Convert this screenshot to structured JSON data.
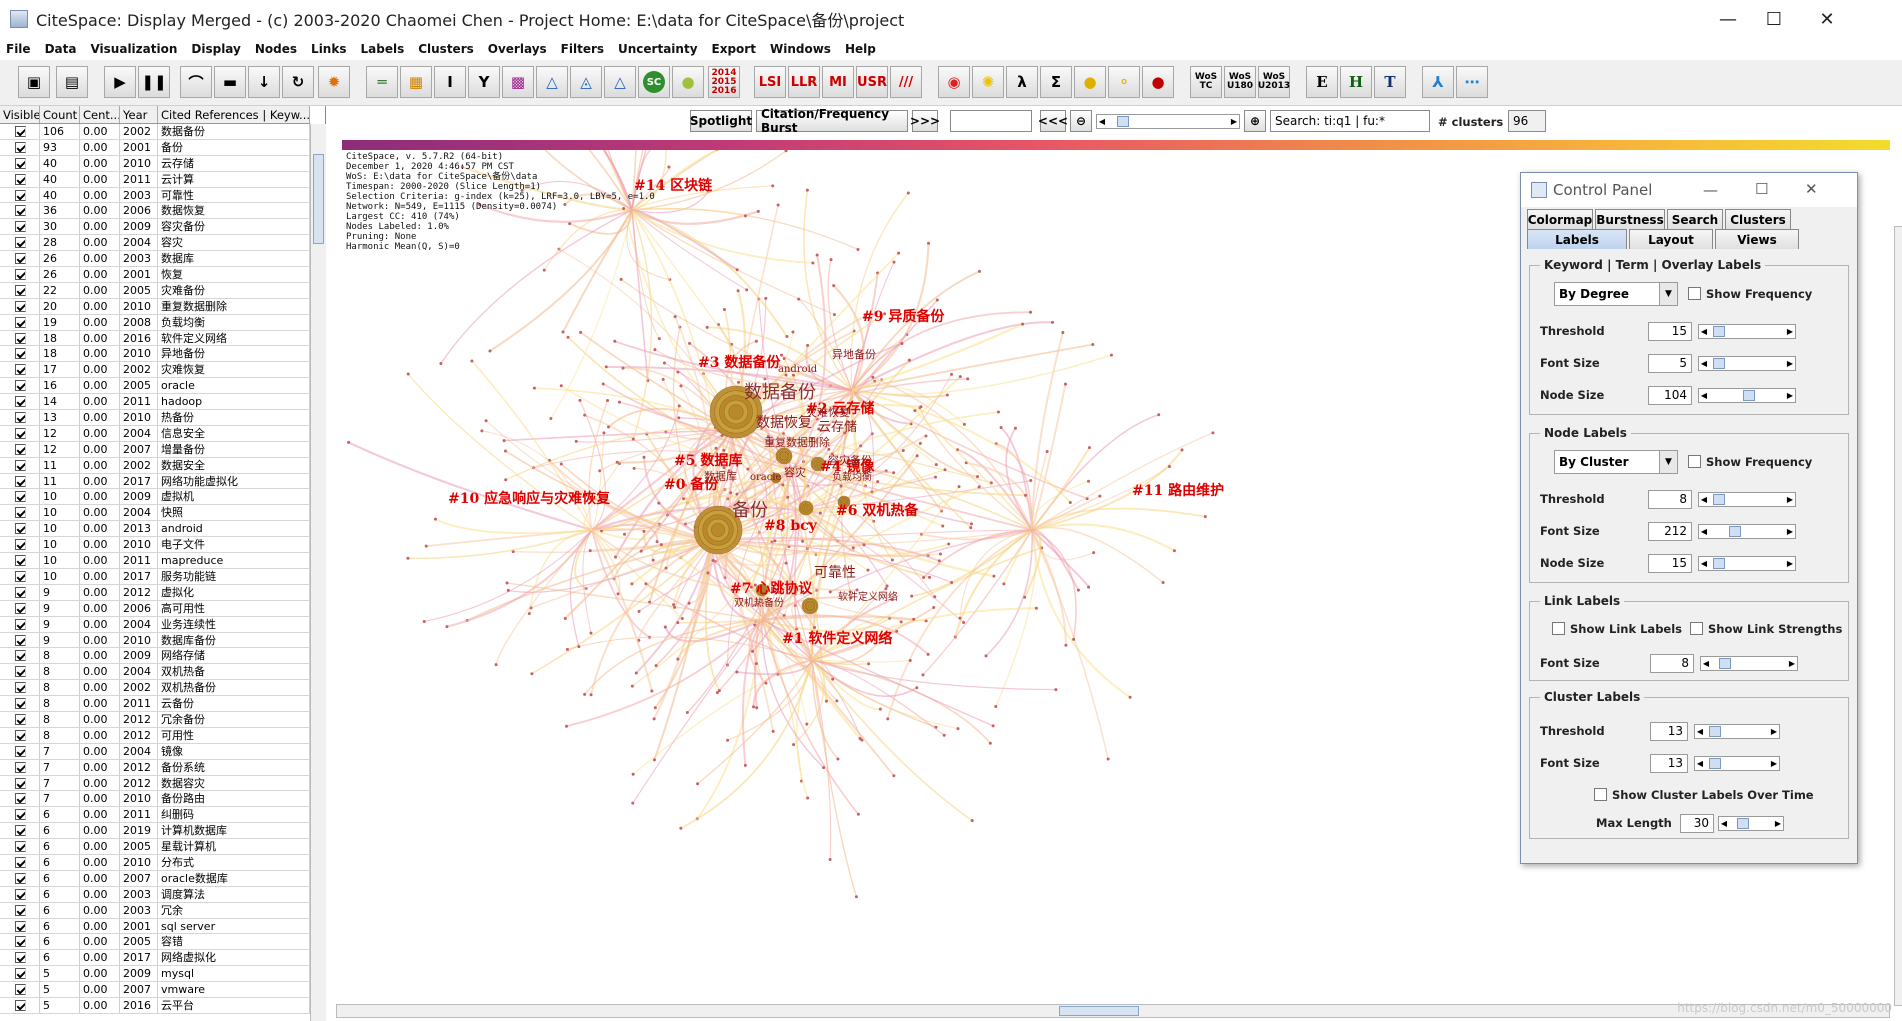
{
  "window": {
    "title": "CiteSpace: Display Merged - (c) 2003-2020 Chaomei Chen - Project Home: E:\\data for CiteSpace\\备份\\project",
    "minimize": "—",
    "maximize": "☐",
    "close": "✕"
  },
  "menu": [
    "File",
    "Data",
    "Visualization",
    "Display",
    "Nodes",
    "Links",
    "Labels",
    "Clusters",
    "Overlays",
    "Filters",
    "Uncertainty",
    "Export",
    "Windows",
    "Help"
  ],
  "toolbar": {
    "year_icon": [
      "2014",
      "2015",
      "2016"
    ],
    "lsi": "LSI",
    "llr": "LLR",
    "mi": "MI",
    "usr": "USR",
    "slash": "///",
    "wos_tc": [
      "WoS",
      "TC"
    ],
    "wos_u180": [
      "WoS",
      "U180"
    ],
    "wos_u2013": [
      "WoS",
      "U2013"
    ],
    "e": "E",
    "h": "H",
    "t": "T",
    "sc": "SC",
    "sigma": "Σ",
    "lambda": "λ"
  },
  "table": {
    "headers": [
      "Visible",
      "Count",
      "Cent...",
      "Year",
      "Cited References | Keyw..."
    ],
    "rows": [
      [
        "106",
        "0.00",
        "2002",
        "数据备份"
      ],
      [
        "93",
        "0.00",
        "2001",
        "备份"
      ],
      [
        "40",
        "0.00",
        "2010",
        "云存储"
      ],
      [
        "40",
        "0.00",
        "2011",
        "云计算"
      ],
      [
        "40",
        "0.00",
        "2003",
        "可靠性"
      ],
      [
        "36",
        "0.00",
        "2006",
        "数据恢复"
      ],
      [
        "30",
        "0.00",
        "2009",
        "容灾备份"
      ],
      [
        "28",
        "0.00",
        "2004",
        "容灾"
      ],
      [
        "26",
        "0.00",
        "2003",
        "数据库"
      ],
      [
        "26",
        "0.00",
        "2001",
        "恢复"
      ],
      [
        "22",
        "0.00",
        "2005",
        "灾难备份"
      ],
      [
        "20",
        "0.00",
        "2010",
        "重复数据删除"
      ],
      [
        "19",
        "0.00",
        "2008",
        "负载均衡"
      ],
      [
        "18",
        "0.00",
        "2016",
        "软件定义网络"
      ],
      [
        "18",
        "0.00",
        "2010",
        "异地备份"
      ],
      [
        "17",
        "0.00",
        "2002",
        "灾难恢复"
      ],
      [
        "16",
        "0.00",
        "2005",
        "oracle"
      ],
      [
        "14",
        "0.00",
        "2011",
        "hadoop"
      ],
      [
        "13",
        "0.00",
        "2010",
        "热备份"
      ],
      [
        "12",
        "0.00",
        "2004",
        "信息安全"
      ],
      [
        "12",
        "0.00",
        "2007",
        "增量备份"
      ],
      [
        "11",
        "0.00",
        "2002",
        "数据安全"
      ],
      [
        "11",
        "0.00",
        "2017",
        "网络功能虚拟化"
      ],
      [
        "10",
        "0.00",
        "2009",
        "虚拟机"
      ],
      [
        "10",
        "0.00",
        "2004",
        "快照"
      ],
      [
        "10",
        "0.00",
        "2013",
        "android"
      ],
      [
        "10",
        "0.00",
        "2010",
        "电子文件"
      ],
      [
        "10",
        "0.00",
        "2011",
        "mapreduce"
      ],
      [
        "10",
        "0.00",
        "2017",
        "服务功能链"
      ],
      [
        "9",
        "0.00",
        "2012",
        "虚拟化"
      ],
      [
        "9",
        "0.00",
        "2006",
        "高可用性"
      ],
      [
        "9",
        "0.00",
        "2004",
        "业务连续性"
      ],
      [
        "9",
        "0.00",
        "2010",
        "数据库备份"
      ],
      [
        "8",
        "0.00",
        "2009",
        "网络存储"
      ],
      [
        "8",
        "0.00",
        "2004",
        "双机热备"
      ],
      [
        "8",
        "0.00",
        "2002",
        "双机热备份"
      ],
      [
        "8",
        "0.00",
        "2011",
        "云备份"
      ],
      [
        "8",
        "0.00",
        "2012",
        "冗余备份"
      ],
      [
        "8",
        "0.00",
        "2012",
        "可用性"
      ],
      [
        "7",
        "0.00",
        "2004",
        "镜像"
      ],
      [
        "7",
        "0.00",
        "2012",
        "备份系统"
      ],
      [
        "7",
        "0.00",
        "2012",
        "数据容灾"
      ],
      [
        "7",
        "0.00",
        "2010",
        "备份路由"
      ],
      [
        "6",
        "0.00",
        "2011",
        "纠删码"
      ],
      [
        "6",
        "0.00",
        "2019",
        "计算机数据库"
      ],
      [
        "6",
        "0.00",
        "2005",
        "星载计算机"
      ],
      [
        "6",
        "0.00",
        "2010",
        "分布式"
      ],
      [
        "6",
        "0.00",
        "2007",
        "oracle数据库"
      ],
      [
        "6",
        "0.00",
        "2003",
        "调度算法"
      ],
      [
        "6",
        "0.00",
        "2003",
        "冗余"
      ],
      [
        "6",
        "0.00",
        "2001",
        "sql server"
      ],
      [
        "6",
        "0.00",
        "2005",
        "容错"
      ],
      [
        "6",
        "0.00",
        "2017",
        "网络虚拟化"
      ],
      [
        "5",
        "0.00",
        "2009",
        "mysql"
      ],
      [
        "5",
        "0.00",
        "2007",
        "vmware"
      ],
      [
        "5",
        "0.00",
        "2016",
        "云平台"
      ]
    ]
  },
  "canvasbar": {
    "spotlight": "Spotlight",
    "burst": "Citation/Frequency Burst",
    "next": ">>>",
    "prev": "<<<",
    "search": "Search: ti:q1 | fu:*",
    "clusters_label": "# clusters",
    "clusters_value": "96"
  },
  "info": [
    "CiteSpace, v. 5.7.R2 (64-bit)",
    "December 1, 2020 4:46:57 PM CST",
    "WoS: E:\\data for CiteSpace\\备份\\data",
    "Timespan: 2000-2020 (Slice Length=1)",
    "Selection Criteria: g-index (k=25), LRF=3.0, LBY=5, e=1.0",
    "Network: N=549, E=1115 (Density=0.0074)",
    "Largest CC: 410 (74%)",
    "Nodes Labeled: 1.0%",
    "Pruning: None",
    "Harmonic Mean(Q, S)=0"
  ],
  "cluster_labels": [
    "#14 区块链",
    "#9 异质备份",
    "#3 数据备份",
    "#2 云存储",
    "#5 数据库",
    "#4 镜像",
    "#0 备份",
    "#10 应急响应与灾难恢复",
    "#8 bcy",
    "#6 双机热备",
    "#11 路由维护",
    "#7 心跳协议",
    "#1 软件定义网络"
  ],
  "node_labels": {
    "n1": "数据备份",
    "n2": "备份",
    "n3": "数据恢复",
    "n4": "云存储",
    "n5": "可靠性",
    "n6": "异地备份",
    "n7": "android",
    "n8": "灾难恢复",
    "n9": "重复数据删除",
    "n10": "容灾备份",
    "n11": "数据库",
    "n12": "oracle",
    "n13": "容灾",
    "n14": "负载均衡",
    "n15": "软件定义网络",
    "n16": "双机热备份"
  },
  "control": {
    "title": "Control Panel",
    "tabs_row1": [
      "Colormap",
      "Burstness",
      "Search",
      "Clusters"
    ],
    "tabs_row2": [
      "Labels",
      "Layout",
      "Views"
    ],
    "keyword_group": "Keyword | Term | Overlay Labels",
    "by_degree": "By Degree",
    "show_frequency": "Show Frequency",
    "threshold": "Threshold",
    "font_size": "Font Size",
    "node_size": "Node Size",
    "kw_threshold": "15",
    "kw_font": "5",
    "kw_node": "104",
    "node_group": "Node Labels",
    "by_cluster": "By Cluster",
    "nl_threshold": "8",
    "nl_font": "212",
    "nl_node": "15",
    "link_group": "Link Labels",
    "show_link_labels": "Show Link Labels",
    "show_link_strengths": "Show Link Strengths",
    "ll_font": "8",
    "cluster_group": "Cluster Labels",
    "cl_threshold": "13",
    "cl_font": "13",
    "over_time": "Show Cluster Labels Over Time",
    "max_length": "Max Length",
    "max_length_value": "30"
  },
  "watermark": "https://blog.csdn.net/m0_50000000"
}
